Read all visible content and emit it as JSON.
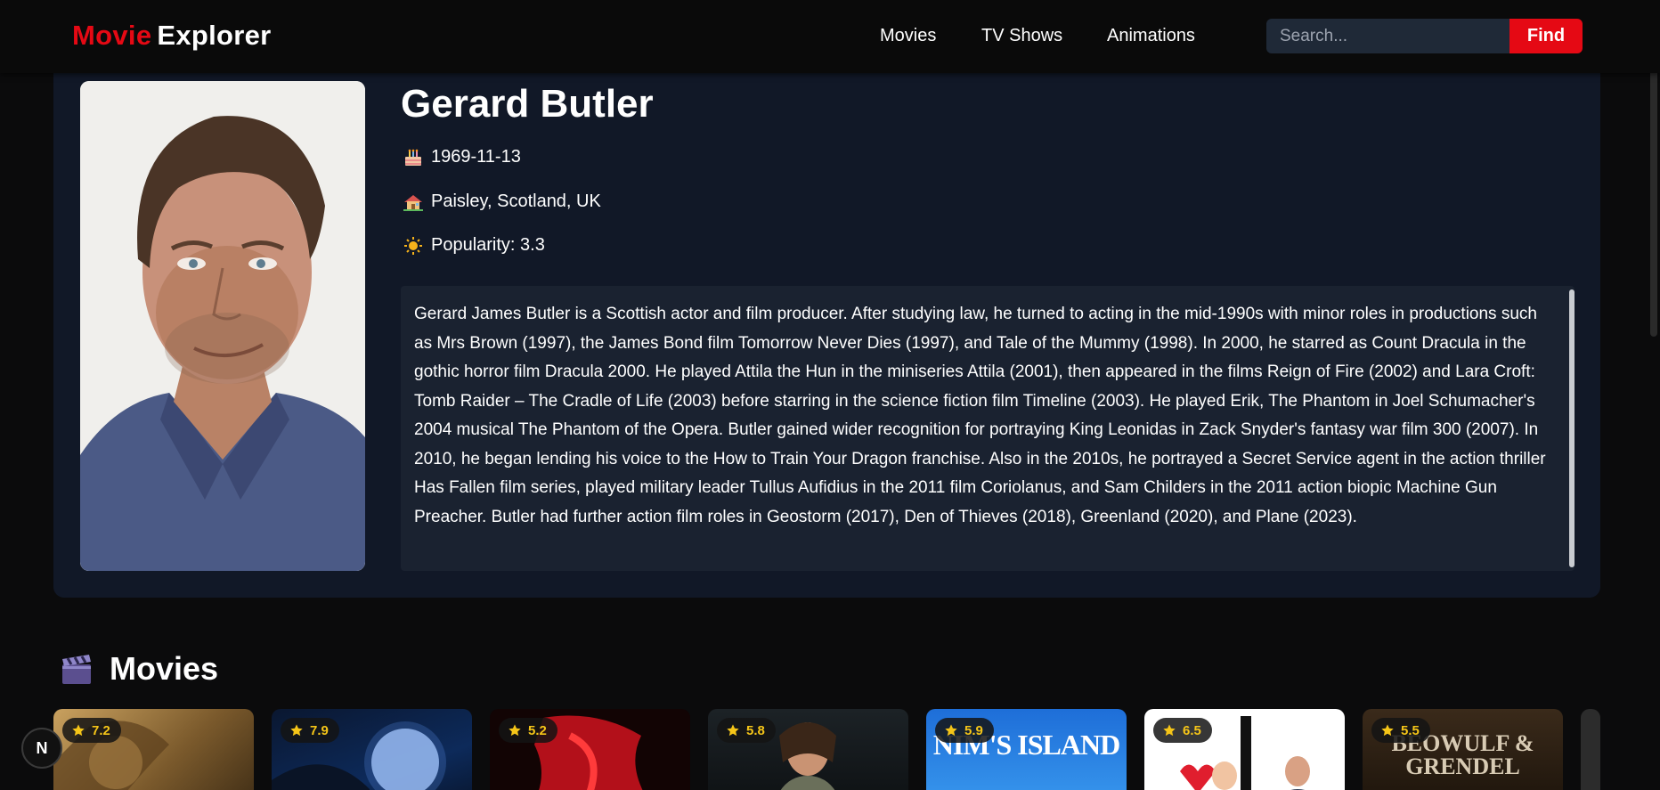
{
  "header": {
    "logo_part1": "Movie",
    "logo_part2": "Explorer",
    "nav": [
      {
        "label": "Movies"
      },
      {
        "label": "TV Shows"
      },
      {
        "label": "Animations"
      }
    ],
    "search_placeholder": "Search...",
    "find_label": "Find"
  },
  "person": {
    "name": "Gerard Butler",
    "birthday": "1969-11-13",
    "birthplace": "Paisley, Scotland, UK",
    "popularity": "Popularity: 3.3",
    "biography": "Gerard James Butler is a Scottish actor and film producer. After studying law, he turned to acting in the mid-1990s with minor roles in productions such as Mrs Brown (1997), the James Bond film Tomorrow Never Dies (1997), and Tale of the Mummy (1998). In 2000, he starred as Count Dracula in the gothic horror film Dracula 2000. He played Attila the Hun in the miniseries Attila (2001), then appeared in the films Reign of Fire (2002) and Lara Croft: Tomb Raider – The Cradle of Life (2003) before starring in the science fiction film Timeline (2003). He played Erik, The Phantom in Joel Schumacher's 2004 musical The Phantom of the Opera. Butler gained wider recognition for portraying King Leonidas in Zack Snyder's fantasy war film 300 (2007). In 2010, he began lending his voice to the How to Train Your Dragon franchise. Also in the 2010s, he portrayed a Secret Service agent in the action thriller Has Fallen film series, played military leader Tullus Aufidius in the 2011 film Coriolanus, and Sam Childers in the 2011 action biopic Machine Gun Preacher. Butler had further action film roles in Geostorm (2017), Den of Thieves (2018), Greenland (2020), and Plane (2023)."
  },
  "movies_section": {
    "title": "Movies",
    "items": [
      {
        "rating": "7.2",
        "poster_title": ""
      },
      {
        "rating": "7.9",
        "poster_title": ""
      },
      {
        "rating": "5.2",
        "poster_title": ""
      },
      {
        "rating": "5.8",
        "poster_title": ""
      },
      {
        "rating": "5.9",
        "poster_title": "NIM'S ISLAND"
      },
      {
        "rating": "6.5",
        "poster_title": ""
      },
      {
        "rating": "5.5",
        "poster_title": "BEOWULF & GRENDEL"
      }
    ]
  },
  "badge": {
    "label": "N"
  },
  "colors": {
    "accent": "#e50914",
    "card": "#111827",
    "bio_bg": "#1a2230",
    "rating": "#f5c518"
  }
}
